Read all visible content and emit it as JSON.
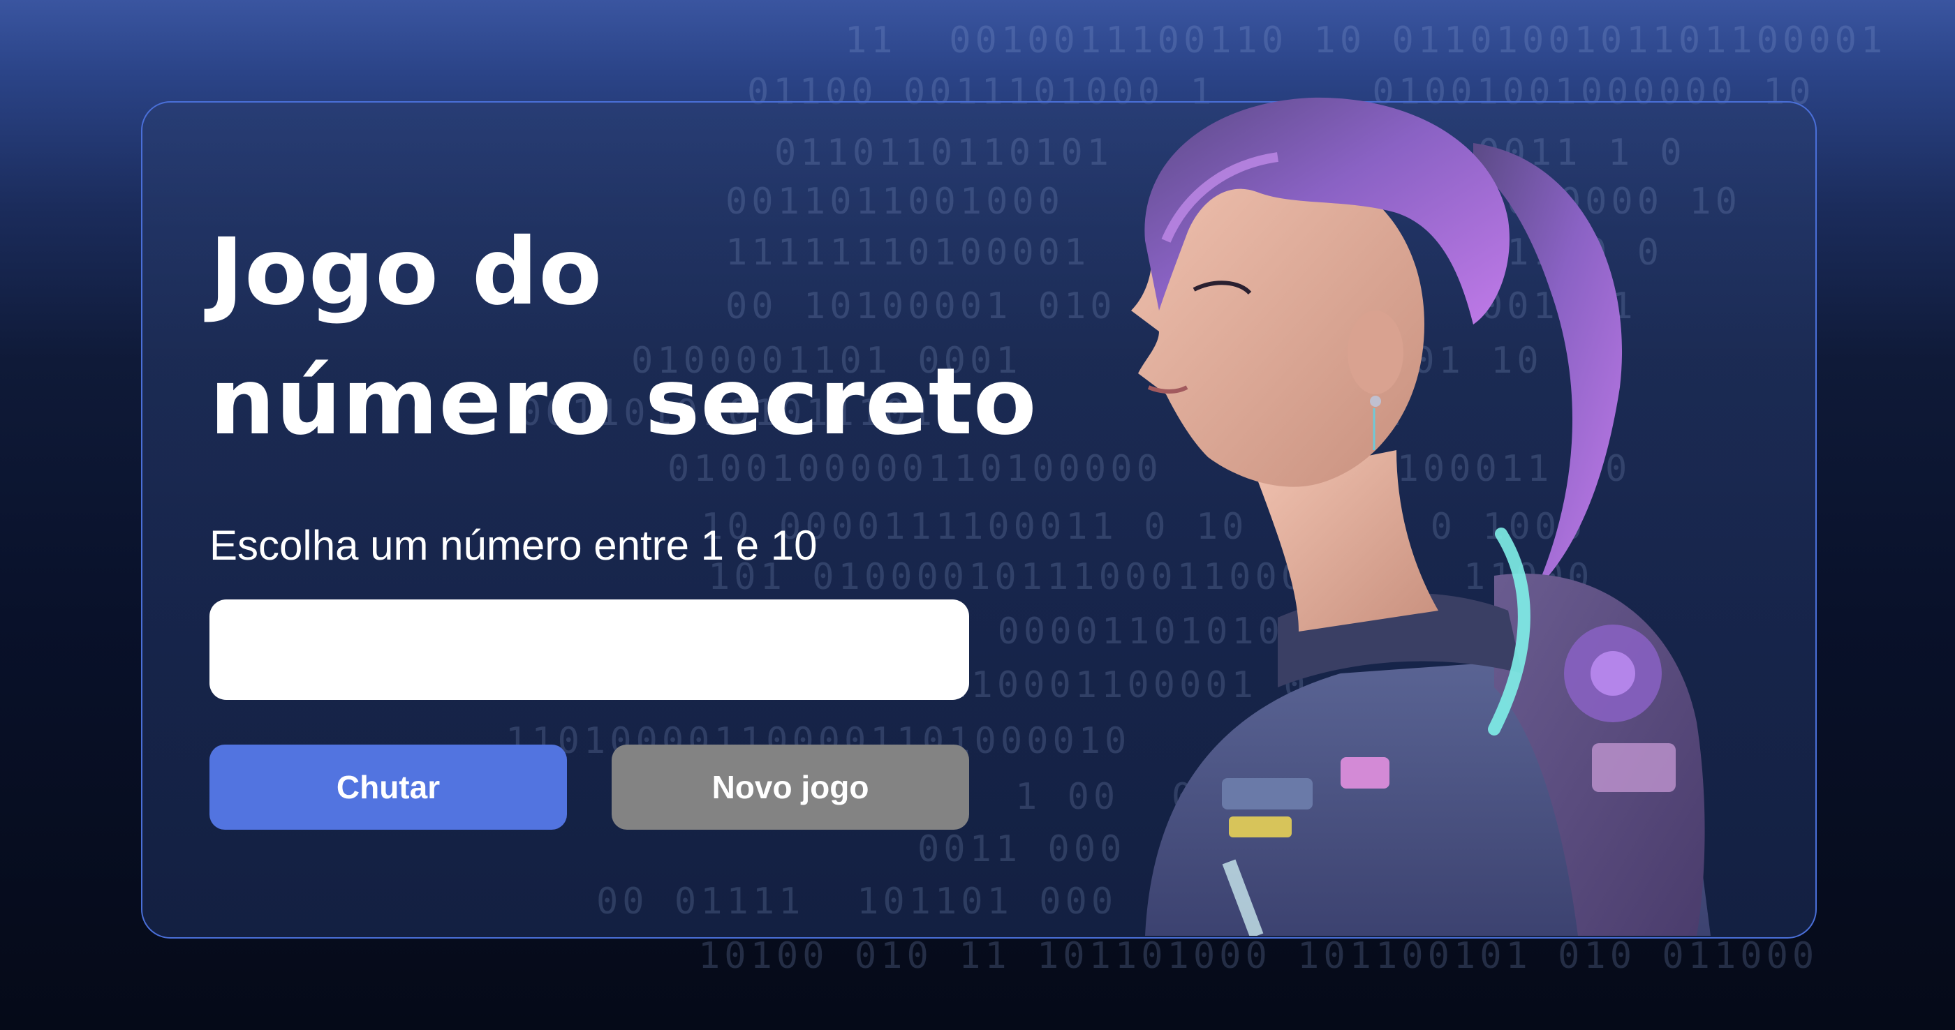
{
  "title": {
    "line1": "Jogo do",
    "line2": "número secreto"
  },
  "prompt": "Escolha um número entre 1 e 10",
  "input": {
    "value": "",
    "placeholder": ""
  },
  "buttons": {
    "guess": "Chutar",
    "new_game": "Novo jogo"
  },
  "illustration": {
    "description_icon": "female-hacker-illustration"
  },
  "colors": {
    "primary_button": "#5274e0",
    "secondary_button": "#838383",
    "card_border": "#4a6fd8"
  },
  "background_binary": [
    "11  0010011100110 10 0110100101101100001",
    "01100 0011101000 1      01001001000000 10",
    "0110110110101              0011 1 0",
    "0011011001000              111010000 10",
    "11111110100001              0011 0 0",
    "00 10100001 010              001011",
    "0100001101 0001              001 10 0",
    "0011010101011101             01101",
    "0100100000110100000        0100011 00",
    "10 0000111100011 0 10       0 1000",
    "101 0100001011100011000      11000",
    "1 00001101010          0",
    "0000110001100001 0",
    "110100001100001101000010",
    "1 00  00011 0110",
    "0011 000",
    "00 01111  101101 000",
    "10100 010 11 101101000 101100101 010 011000"
  ]
}
